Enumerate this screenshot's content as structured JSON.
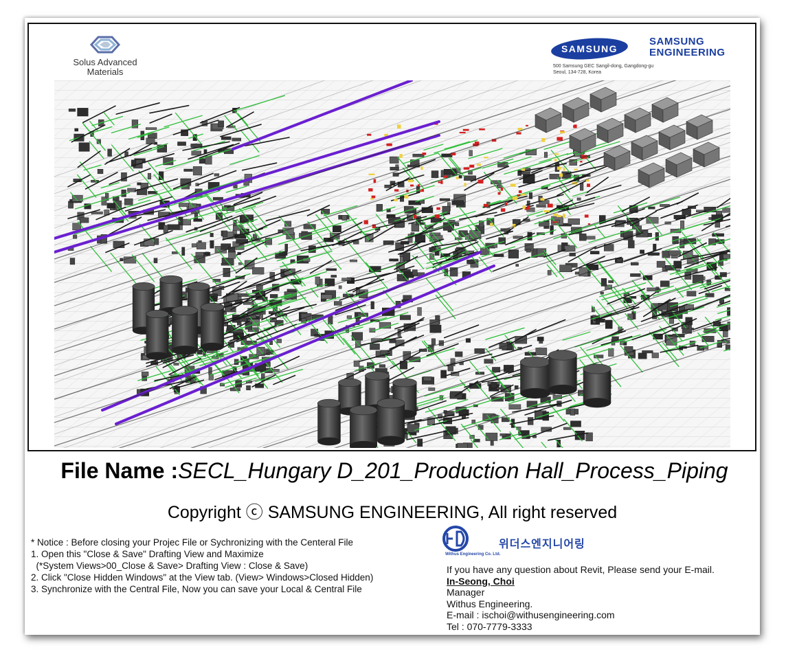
{
  "header": {
    "left_logo_text": [
      "Solus Advanced",
      "Materials"
    ],
    "samsung_oval_text": "SAMSUNG",
    "samsung_engineering": [
      "SAMSUNG",
      "ENGINEERING"
    ],
    "address": [
      "500 Samsung GEC Sangil-dong, Gangdong-gu",
      "Seoul, 134-728, Korea"
    ]
  },
  "file": {
    "label": "File Name :",
    "name": "SECL_Hungary D_201_Production Hall_Process_Piping"
  },
  "copyright": "Copyright ⓒ  SAMSUNG ENGINEERING, All right reserved",
  "notice": {
    "lines": [
      "* Notice : Before closing your Projec File or Sychronizing with the Centeral File",
      "",
      "1. Open this \"Close & Save\" Drafting View and Maximize",
      "  (*System Views>00_Close & Save> Drafting View : Close & Save)",
      "",
      "2. Click \"Close Hidden Windows\" at the View tab. (View> Windows>Closed Hidden)",
      "",
      "3. Synchronize with the Central File, Now you can save your Local & Central File"
    ]
  },
  "withus": {
    "korean_name": "위더스엔지니어링",
    "small_name": "Withus Engineering Co. Ltd."
  },
  "contact": {
    "intro": "If you have any question about Revit, Please send your E-mail.",
    "name": "In-Seong, Choi",
    "title": "Manager",
    "company": "Withus Engineering.",
    "email": "E-mail : ischoi@withusengineering.com",
    "tel": "Tel : 070-7779-3333"
  },
  "colors": {
    "samsung_blue": "#1b3fa0",
    "pipe_green": "#2fbf3a",
    "pipe_purple": "#6a1fd0",
    "pipe_red": "#d42020",
    "equipment_gray": "#4a4a4a"
  }
}
